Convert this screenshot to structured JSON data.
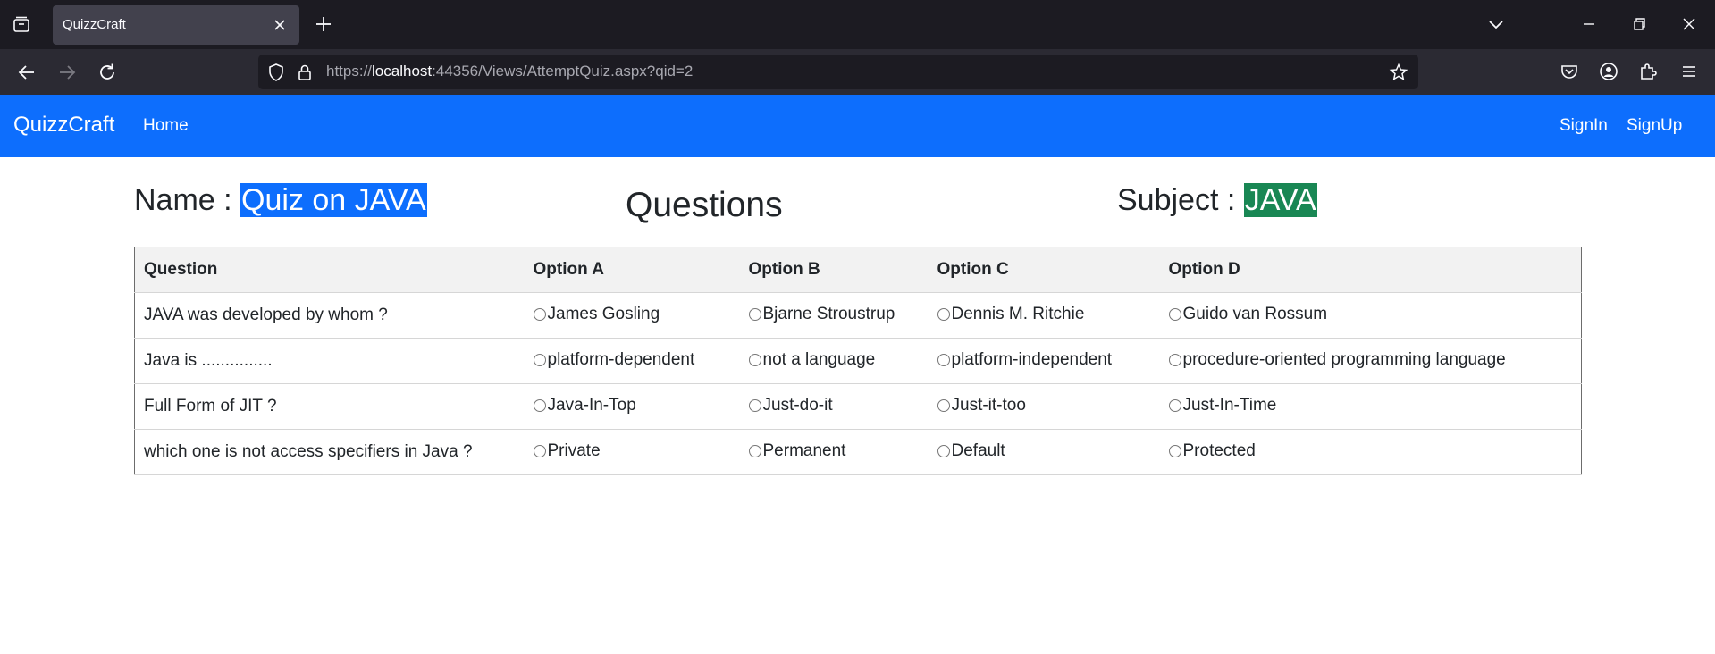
{
  "browser": {
    "tab_title": "QuizzCraft",
    "url_prefix": "https://",
    "url_host": "localhost",
    "url_rest": ":44356/Views/AttemptQuiz.aspx?qid=2"
  },
  "site": {
    "brand": "QuizzCraft",
    "nav_home": "Home",
    "nav_signin": "SignIn",
    "nav_signup": "SignUp",
    "accent_color": "#0d6efd",
    "subject_color": "#198754"
  },
  "quiz": {
    "name_label": "Name : ",
    "name_value": "Quiz on JAVA",
    "title": "Questions",
    "subject_label": "Subject : ",
    "subject_value": "JAVA",
    "headers": [
      "Question",
      "Option A",
      "Option B",
      "Option C",
      "Option D"
    ],
    "rows": [
      {
        "question": "JAVA was developed by whom ?",
        "options": [
          "James Gosling",
          "Bjarne Stroustrup",
          "Dennis M. Ritchie",
          "Guido van Rossum"
        ]
      },
      {
        "question": "Java is ...............",
        "options": [
          "platform-dependent",
          "not a language",
          "platform-independent",
          "procedure-oriented programming language"
        ]
      },
      {
        "question": "Full Form of JIT ?",
        "options": [
          "Java-In-Top",
          "Just-do-it",
          "Just-it-too",
          "Just-In-Time"
        ]
      },
      {
        "question": "which one is not access specifiers in Java ?",
        "options": [
          "Private",
          "Permanent",
          "Default",
          "Protected"
        ]
      }
    ]
  }
}
